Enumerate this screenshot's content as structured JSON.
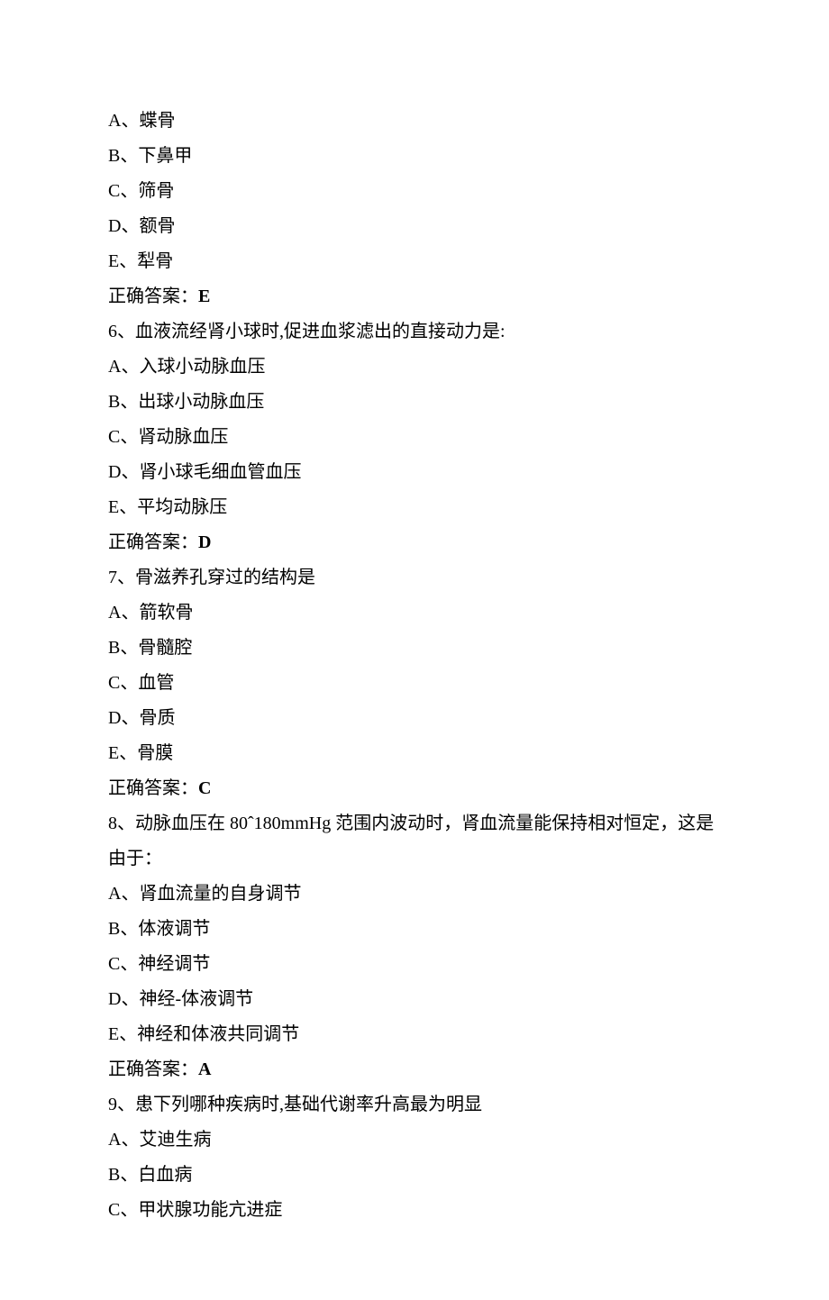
{
  "q5_options": {
    "A": "A、蝶骨",
    "B": "B、下鼻甲",
    "C": "C、筛骨",
    "D": "D、额骨",
    "E": "E、犁骨"
  },
  "q5_answer_label": "正确答案：",
  "q5_answer_value": "E",
  "q6_stem": "6、血液流经肾小球时,促进血浆滤出的直接动力是:",
  "q6_options": {
    "A": "A、入球小动脉血压",
    "B": "B、出球小动脉血压",
    "C": "C、肾动脉血压",
    "D": "D、肾小球毛细血管血压",
    "E": "E、平均动脉压"
  },
  "q6_answer_label": "正确答案：",
  "q6_answer_value": "D",
  "q7_stem": "7、骨滋养孔穿过的结构是",
  "q7_options": {
    "A": "A、箭软骨",
    "B": "B、骨髓腔",
    "C": "C、血管",
    "D": "D、骨质",
    "E": "E、骨膜"
  },
  "q7_answer_label": "正确答案：",
  "q7_answer_value": "C",
  "q8_stem": "8、动脉血压在 80ˆ180mmHg 范围内波动时，肾血流量能保持相对恒定，这是由于：",
  "q8_options": {
    "A": "A、肾血流量的自身调节",
    "B": "B、体液调节",
    "C": "C、神经调节",
    "D": "D、神经-体液调节",
    "E": "E、神经和体液共同调节"
  },
  "q8_answer_label": "正确答案：",
  "q8_answer_value": "A",
  "q9_stem": "9、患下列哪种疾病时,基础代谢率升高最为明显",
  "q9_options": {
    "A": "A、艾迪生病",
    "B": "B、白血病",
    "C": "C、甲状腺功能亢进症"
  }
}
